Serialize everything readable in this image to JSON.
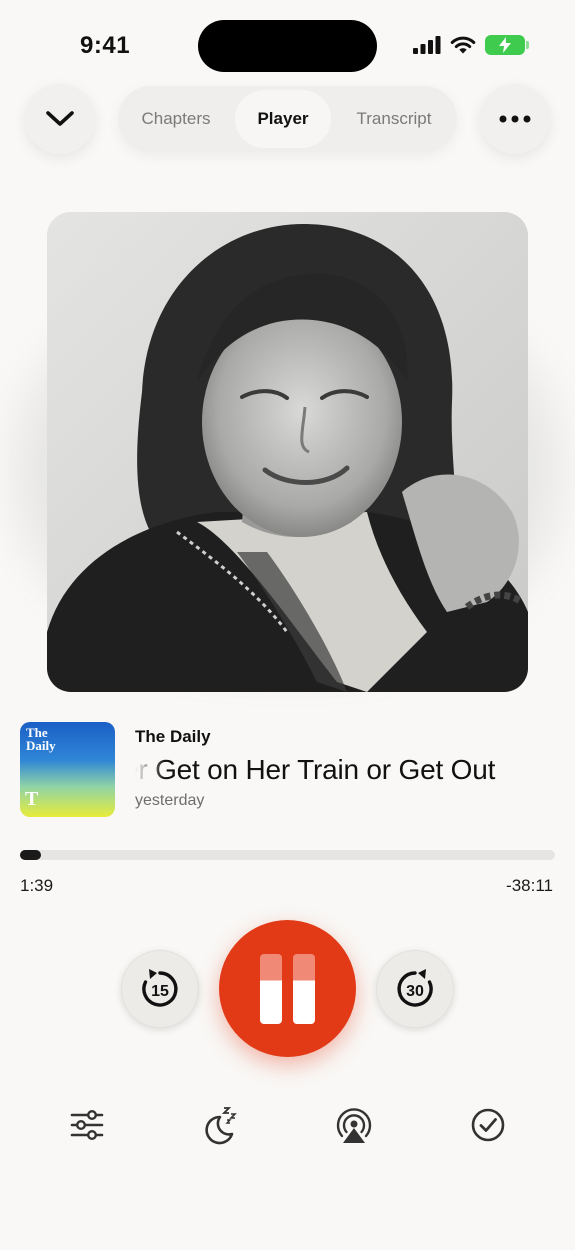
{
  "status_bar": {
    "time": "9:41"
  },
  "nav": {
    "tabs": [
      {
        "label": "Chapters",
        "active": false
      },
      {
        "label": "Player",
        "active": true
      },
      {
        "label": "Transcript",
        "active": false
      }
    ],
    "collapse_icon": "chevron-down-icon",
    "more_icon": "ellipsis-icon"
  },
  "episode": {
    "show_name": "The Daily",
    "title": "er Get on Her Train or Get Out",
    "date": "yesterday",
    "cover": {
      "title_line1": "The",
      "title_line2": "Daily",
      "logo": "T"
    }
  },
  "playback": {
    "elapsed": "1:39",
    "remaining": "-38:11",
    "progress": 0.04,
    "state": "playing"
  },
  "controls": {
    "skip_back_label": "15",
    "skip_forward_label": "30",
    "accent_color": "#e23a17"
  },
  "toolbar": {
    "items": [
      "equalizer-icon",
      "sleep-timer-icon",
      "airplay-icon",
      "mark-played-icon"
    ]
  }
}
